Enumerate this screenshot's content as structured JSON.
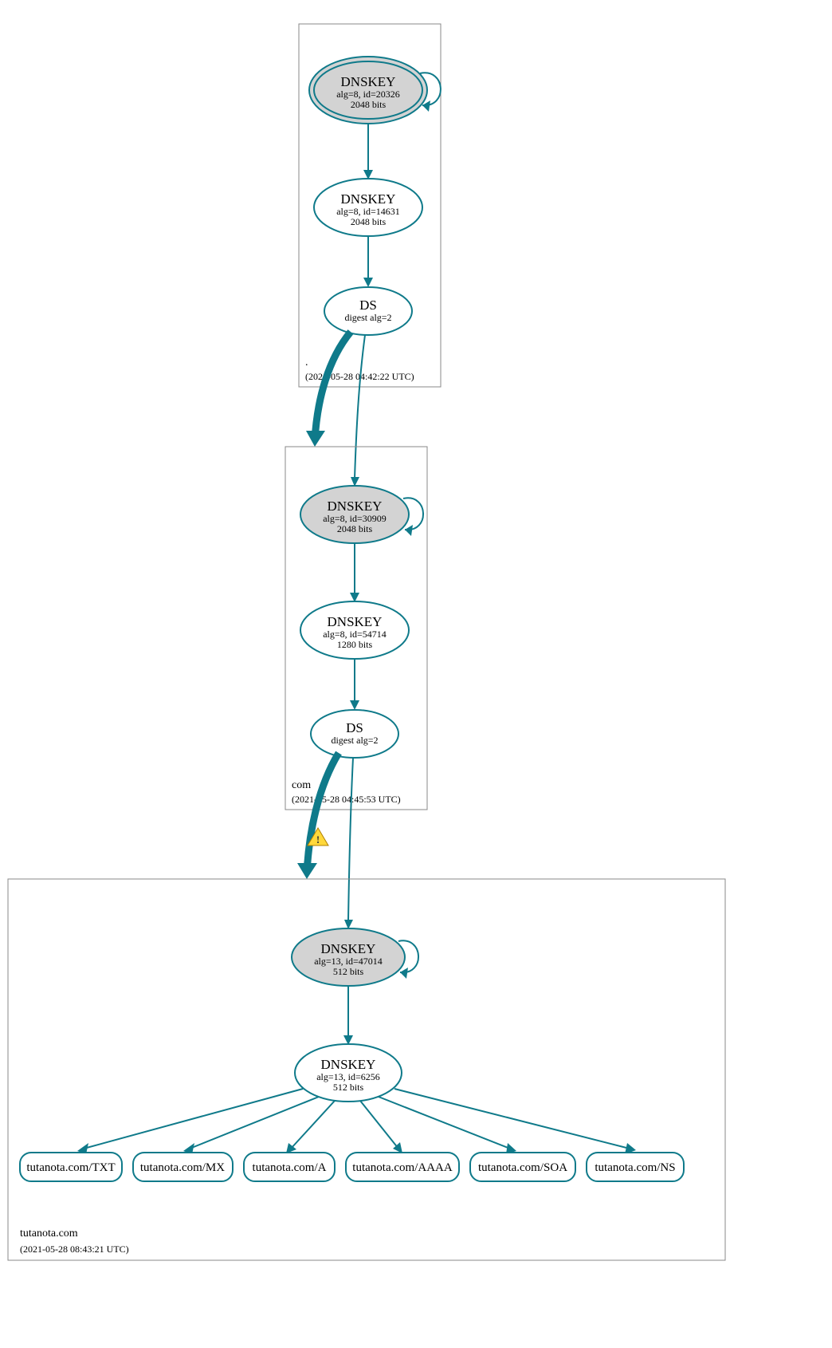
{
  "chart_data": {
    "type": "graph",
    "zones": [
      {
        "name": ".",
        "timestamp": "(2021-05-28 04:42:22 UTC)",
        "nodes": [
          {
            "id": "root-ksk",
            "type": "DNSKEY",
            "title": "DNSKEY",
            "line2": "alg=8, id=20326",
            "line3": "2048 bits",
            "ksk": true,
            "selfloop": true
          },
          {
            "id": "root-zsk",
            "type": "DNSKEY",
            "title": "DNSKEY",
            "line2": "alg=8, id=14631",
            "line3": "2048 bits"
          },
          {
            "id": "root-ds",
            "type": "DS",
            "title": "DS",
            "line2": "digest alg=2"
          }
        ],
        "edges": [
          {
            "from": "root-ksk",
            "to": "root-zsk"
          },
          {
            "from": "root-zsk",
            "to": "root-ds"
          }
        ]
      },
      {
        "name": "com",
        "timestamp": "(2021-05-28 04:45:53 UTC)",
        "nodes": [
          {
            "id": "com-ksk",
            "type": "DNSKEY",
            "title": "DNSKEY",
            "line2": "alg=8, id=30909",
            "line3": "2048 bits",
            "ksk": true,
            "selfloop": true
          },
          {
            "id": "com-zsk",
            "type": "DNSKEY",
            "title": "DNSKEY",
            "line2": "alg=8, id=54714",
            "line3": "1280 bits"
          },
          {
            "id": "com-ds",
            "type": "DS",
            "title": "DS",
            "line2": "digest alg=2"
          }
        ],
        "edges": [
          {
            "from": "com-ksk",
            "to": "com-zsk"
          },
          {
            "from": "com-zsk",
            "to": "com-ds"
          }
        ]
      },
      {
        "name": "tutanota.com",
        "timestamp": "(2021-05-28 08:43:21 UTC)",
        "nodes": [
          {
            "id": "tut-ksk",
            "type": "DNSKEY",
            "title": "DNSKEY",
            "line2": "alg=13, id=47014",
            "line3": "512 bits",
            "ksk": true,
            "selfloop": true
          },
          {
            "id": "tut-zsk",
            "type": "DNSKEY",
            "title": "DNSKEY",
            "line2": "alg=13, id=6256",
            "line3": "512 bits"
          }
        ],
        "leaves": [
          {
            "id": "leaf-txt",
            "label": "tutanota.com/TXT"
          },
          {
            "id": "leaf-mx",
            "label": "tutanota.com/MX"
          },
          {
            "id": "leaf-a",
            "label": "tutanota.com/A"
          },
          {
            "id": "leaf-aaaa",
            "label": "tutanota.com/AAAA"
          },
          {
            "id": "leaf-soa",
            "label": "tutanota.com/SOA"
          },
          {
            "id": "leaf-ns",
            "label": "tutanota.com/NS"
          }
        ],
        "edges": [
          {
            "from": "tut-ksk",
            "to": "tut-zsk"
          },
          {
            "from": "tut-zsk",
            "to": "leaf-txt"
          },
          {
            "from": "tut-zsk",
            "to": "leaf-mx"
          },
          {
            "from": "tut-zsk",
            "to": "leaf-a"
          },
          {
            "from": "tut-zsk",
            "to": "leaf-aaaa"
          },
          {
            "from": "tut-zsk",
            "to": "leaf-soa"
          },
          {
            "from": "tut-zsk",
            "to": "leaf-ns"
          }
        ]
      }
    ],
    "interzone_edges": [
      {
        "from": "root-ds",
        "to": "com-zone",
        "thick": true
      },
      {
        "from": "root-ds",
        "to": "com-ksk"
      },
      {
        "from": "com-ds",
        "to": "tut-zone",
        "thick": true,
        "warning": true
      },
      {
        "from": "com-ds",
        "to": "tut-ksk"
      }
    ]
  }
}
